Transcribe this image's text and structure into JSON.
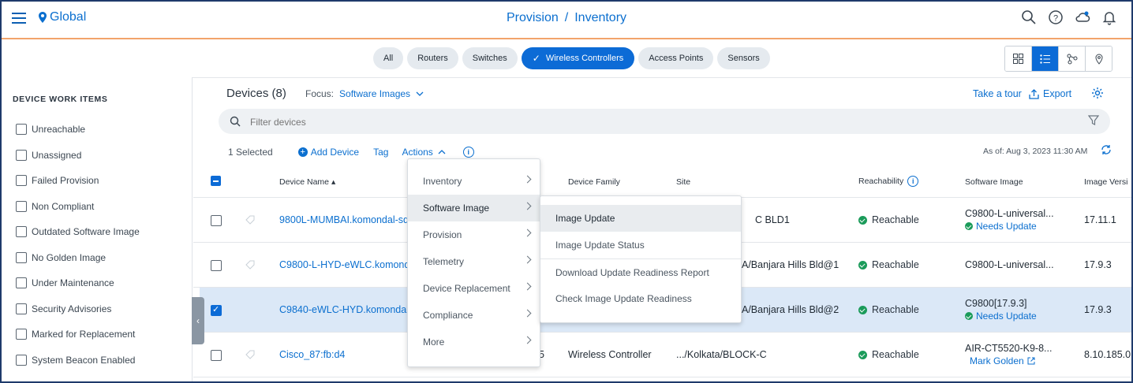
{
  "header": {
    "location": "Global",
    "crumb1": "Provision",
    "separator": "/",
    "crumb2": "Inventory"
  },
  "filters": [
    {
      "label": "All",
      "active": false
    },
    {
      "label": "Routers",
      "active": false
    },
    {
      "label": "Switches",
      "active": false
    },
    {
      "label": "Wireless Controllers",
      "active": true
    },
    {
      "label": "Access Points",
      "active": false
    },
    {
      "label": "Sensors",
      "active": false
    }
  ],
  "sidebar": {
    "title": "DEVICE WORK ITEMS",
    "items": [
      {
        "label": "Unreachable"
      },
      {
        "label": "Unassigned"
      },
      {
        "label": "Failed Provision"
      },
      {
        "label": "Non Compliant"
      },
      {
        "label": "Outdated Software Image"
      },
      {
        "label": "No Golden Image"
      },
      {
        "label": "Under Maintenance"
      },
      {
        "label": "Security Advisories"
      },
      {
        "label": "Marked for Replacement"
      },
      {
        "label": "System Beacon Enabled"
      }
    ]
  },
  "main": {
    "devices_title": "Devices (8)",
    "focus_label": "Focus:",
    "focus_value": "Software Images",
    "take_tour": "Take a tour",
    "export": "Export",
    "search_placeholder": "Filter devices",
    "selected": "1 Selected",
    "add_device": "Add Device",
    "tag": "Tag",
    "actions": "Actions",
    "as_of": "As of: Aug 3, 2023 11:30 AM"
  },
  "table": {
    "headers": {
      "device_name": "Device Name",
      "device_family": "Device Family",
      "site": "Site",
      "reachability": "Reachability",
      "software_image": "Software Image",
      "image_version": "Image Versi"
    },
    "rows": [
      {
        "name": "9800L-MUMBAI.komondal-sda",
        "family": "",
        "site": "C BLD1",
        "reach": "Reachable",
        "image": "C9800-L-universal...",
        "image_status": "Needs Update",
        "version": "17.11.1",
        "selected": false
      },
      {
        "name": "C9800-L-HYD-eWLC.komond",
        "family": "",
        "site": "A/Banjara Hills Bld@1",
        "reach": "Reachable",
        "image": "C9800-L-universal...",
        "image_status": "",
        "version": "17.9.3",
        "selected": false
      },
      {
        "name": "C9840-eWLC-HYD.komondal-",
        "family": "",
        "site": "A/Banjara Hills Bld@2",
        "reach": "Reachable",
        "image": "C9800[17.9.3]",
        "image_status": "Needs Update",
        "version": "17.9.3",
        "selected": true
      },
      {
        "name": "Cisco_87:fb:d4",
        "extra": "5",
        "family": "Wireless Controller",
        "site": ".../Kolkata/BLOCK-C",
        "reach": "Reachable",
        "image": "AIR-CT5520-K9-8...",
        "image_status": "Mark Golden",
        "version": "8.10.185.0",
        "selected": false
      }
    ]
  },
  "actions_menu": {
    "items": [
      {
        "label": "Inventory"
      },
      {
        "label": "Software Image"
      },
      {
        "label": "Provision"
      },
      {
        "label": "Telemetry"
      },
      {
        "label": "Device Replacement"
      },
      {
        "label": "Compliance"
      },
      {
        "label": "More"
      }
    ]
  },
  "software_submenu": {
    "items": [
      {
        "label": "Image Update"
      },
      {
        "label": "Image Update Status"
      },
      {
        "label": "Download Update Readiness Report"
      },
      {
        "label": "Check Image Update Readiness"
      }
    ]
  },
  "colors": {
    "accent": "#0c6bd6",
    "reachable": "#1b9b5a",
    "header_rule": "#f2a46b"
  }
}
